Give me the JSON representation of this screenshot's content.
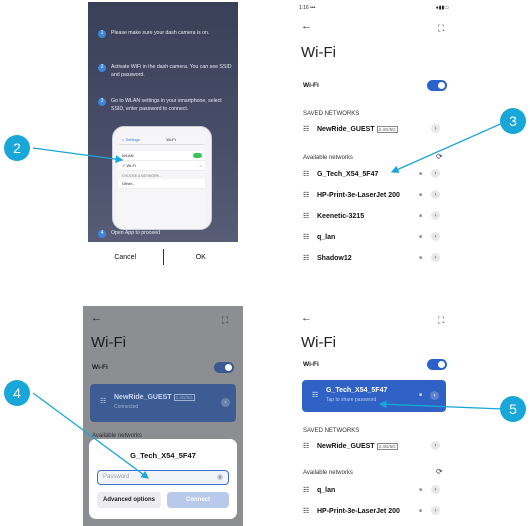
{
  "panel1": {
    "steps": [
      {
        "num": "1",
        "text": "Please make sure your dash camera is on."
      },
      {
        "num": "2",
        "text": "Activate WiFi in the dash camera. You can see SSID and password."
      },
      {
        "num": "3",
        "text": "Go to WLAN settings in your smartphone, select SSID, enter password to connect."
      },
      {
        "num": "4",
        "text": "Open App to proceed"
      }
    ],
    "phone": {
      "back": "< Settings",
      "title": "Wi-Fi",
      "wlan": "WLAN",
      "ssid": "✓ Wi-Fi",
      "choose": "CHOOSE A NETWORK...",
      "other": "Other..."
    },
    "cancel": "Cancel",
    "ok": "OK"
  },
  "panel2": {
    "status_time": "1:16",
    "status_right": "•••",
    "title": "Wi-Fi",
    "wifi_label": "Wi-Fi",
    "saved_header": "SAVED NETWORKS",
    "saved": [
      {
        "name": "NewRide_GUEST",
        "badge": "2.4G/5G"
      }
    ],
    "available_header": "Available networks",
    "available": [
      {
        "name": "G_Tech_X54_5F47"
      },
      {
        "name": "HP-Print-3e-LaserJet 200"
      },
      {
        "name": "Keenetic-3215"
      },
      {
        "name": "q_lan"
      },
      {
        "name": "Shadow12"
      }
    ]
  },
  "panel3": {
    "title": "Wi-Fi",
    "wifi_label": "Wi-Fi",
    "saved_name": "NewRide_GUEST",
    "saved_badge": "2.4G/5G",
    "saved_status": "Connected",
    "available_header": "Available networks",
    "dialog_title": "G_Tech_X54_5F47",
    "password_placeholder": "Password",
    "advanced": "Advanced options",
    "connect": "Connect"
  },
  "panel4": {
    "title": "Wi-Fi",
    "wifi_label": "Wi-Fi",
    "connected_name": "G_Tech_X54_5F47",
    "connected_status": "Tap to share password",
    "saved_header": "SAVED NETWORKS",
    "saved": [
      {
        "name": "NewRide_GUEST",
        "badge": "2.4G/5G"
      }
    ],
    "available_header": "Available networks",
    "available": [
      {
        "name": "q_lan"
      },
      {
        "name": "HP-Print-3e-LaserJet 200"
      }
    ]
  },
  "callouts": {
    "c2": "2",
    "c3": "3",
    "c4": "4",
    "c5": "5"
  },
  "colors": {
    "callout": "#19a6d8",
    "accent": "#2f62c4"
  }
}
